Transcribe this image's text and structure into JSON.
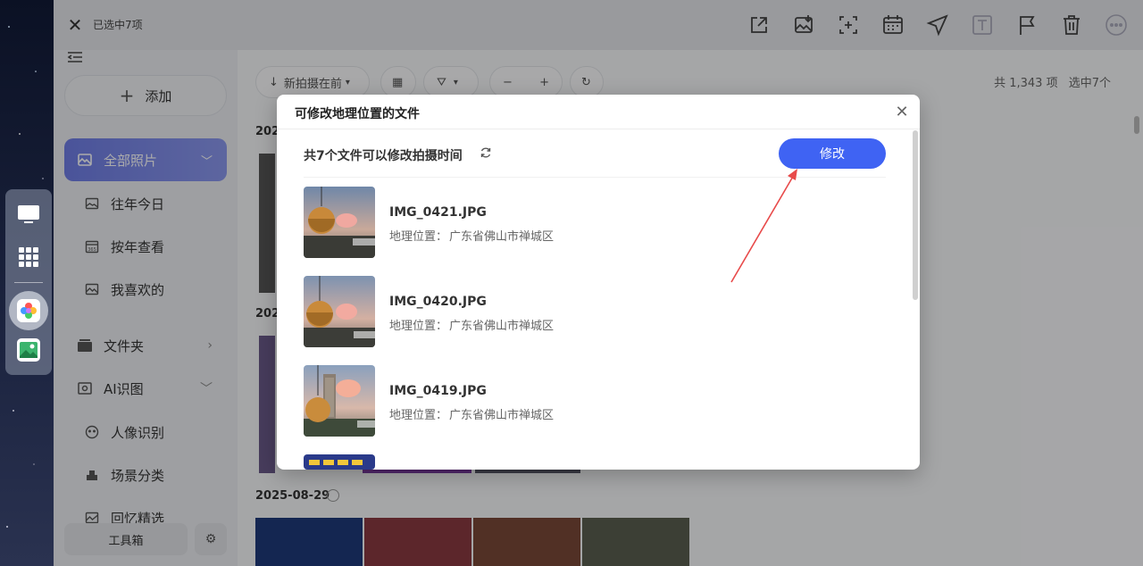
{
  "titlebar": {
    "title": "已选中7项",
    "icons": [
      "share-icon",
      "export-icon",
      "crop-icon",
      "calendar-icon",
      "location-icon",
      "text-icon",
      "flag-icon",
      "delete-icon",
      "more-icon"
    ]
  },
  "sidebar": {
    "add_label": "添加",
    "active": {
      "label": "全部照片"
    },
    "items": [
      {
        "label": "往年今日",
        "icon": "photo-icon"
      },
      {
        "label": "按年查看",
        "icon": "calendar-365-icon"
      },
      {
        "label": "我喜欢的",
        "icon": "image-icon"
      },
      {
        "label": "文件夹",
        "icon": "folder-icon"
      },
      {
        "label": "AI识图",
        "icon": "ai-scan-icon"
      },
      {
        "label": "人像识别",
        "icon": "face-icon"
      },
      {
        "label": "场景分类",
        "icon": "scene-icon"
      },
      {
        "label": "回忆精选",
        "icon": "memory-icon"
      }
    ],
    "toolbox_label": "工具箱"
  },
  "content": {
    "sort_label": "新拍摄在前",
    "total": "共 1,343 项",
    "selected": "选中7个",
    "dates": [
      "202",
      "202",
      "2025-08-29"
    ]
  },
  "modal": {
    "title": "可修改地理位置的文件",
    "summary": "共7个文件可以修改拍摄时间",
    "modify_label": "修改",
    "location_label": "地理位置：",
    "files": [
      {
        "name": "IMG_0421.JPG",
        "location": "广东省佛山市禅城区"
      },
      {
        "name": "IMG_0420.JPG",
        "location": "广东省佛山市禅城区"
      },
      {
        "name": "IMG_0419.JPG",
        "location": "广东省佛山市禅城区"
      }
    ]
  },
  "colors": {
    "accent": "#3f63f3",
    "active_nav": "#7482e8",
    "annotation": "#e84a4a"
  }
}
